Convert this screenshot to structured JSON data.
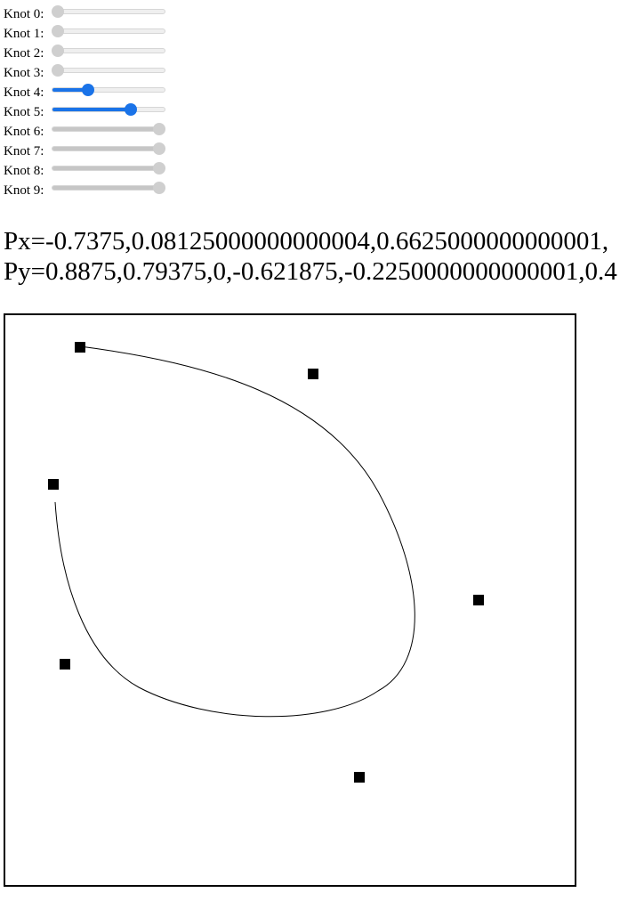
{
  "knots": [
    {
      "label": "Knot 0:",
      "value": 0.0
    },
    {
      "label": "Knot 1:",
      "value": 0.0
    },
    {
      "label": "Knot 2:",
      "value": 0.0
    },
    {
      "label": "Knot 3:",
      "value": 0.0
    },
    {
      "label": "Knot 4:",
      "value": 0.3
    },
    {
      "label": "Knot 5:",
      "value": 0.72
    },
    {
      "label": "Knot 6:",
      "value": 1.0
    },
    {
      "label": "Knot 7:",
      "value": 1.0
    },
    {
      "label": "Knot 8:",
      "value": 1.0
    },
    {
      "label": "Knot 9:",
      "value": 1.0
    }
  ],
  "readout": {
    "px": "Px=-0.7375,0.08125000000000004,0.6625000000000001,",
    "py": "Py=0.8875,0.79375,0,-0.621875,-0.2250000000000001,0.4"
  },
  "colors": {
    "accent": "#1a73e8",
    "inactive": "#cfcfcf"
  }
}
